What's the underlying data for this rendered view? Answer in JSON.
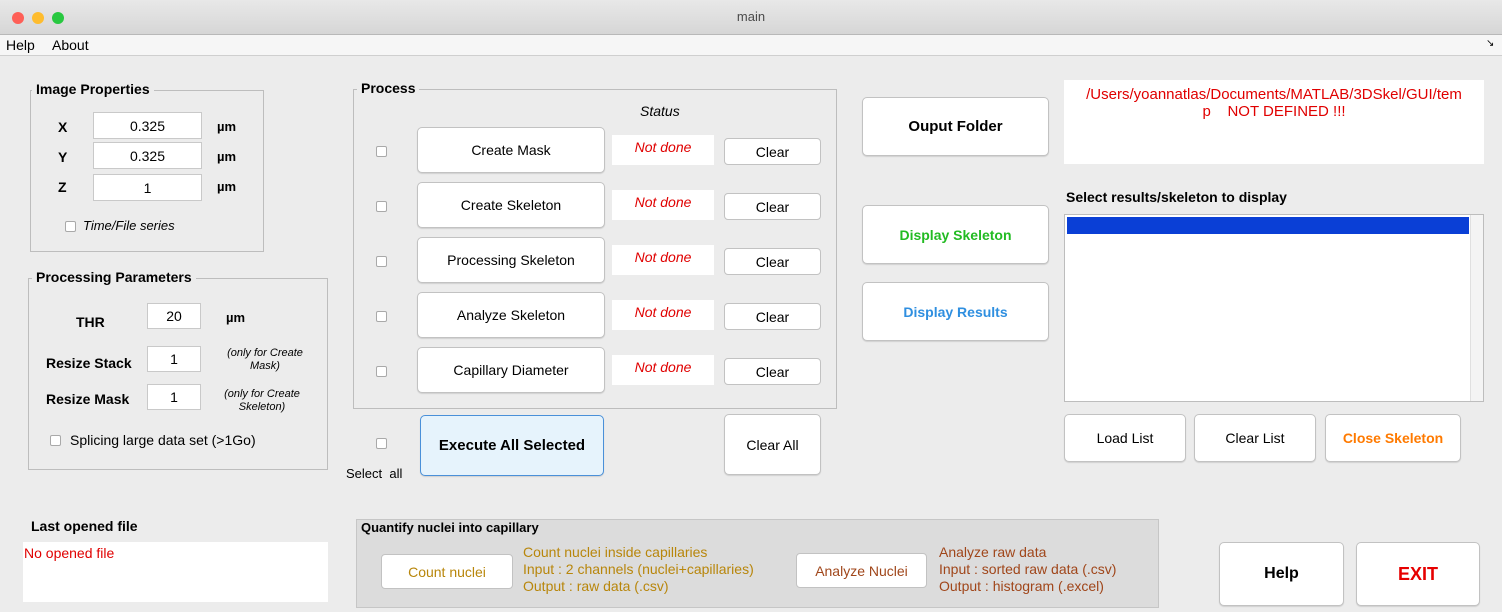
{
  "window": {
    "title": "main"
  },
  "menu": {
    "items": [
      "Help",
      "About"
    ],
    "corner_glyph": "↘"
  },
  "image_properties": {
    "title": "Image Properties",
    "x_label": "X",
    "x_value": "0.325",
    "y_label": "Y",
    "y_value": "0.325",
    "z_label": "Z",
    "z_value": "1",
    "unit": "µm",
    "time_series_label": "Time/File series"
  },
  "processing": {
    "title": "Processing Parameters",
    "thr_label": "THR",
    "thr_value": "20",
    "thr_unit": "µm",
    "resize_stack_label": "Resize Stack",
    "resize_stack_value": "1",
    "resize_stack_note": "(only for Create Mask)",
    "resize_mask_label": "Resize Mask",
    "resize_mask_value": "1",
    "resize_mask_note": "(only for Create Skeleton)",
    "splicing_label": "Splicing large data set (>1Go)"
  },
  "process": {
    "title": "Process",
    "status_header": "Status",
    "steps": [
      {
        "label": "Create Mask",
        "status": "Not done",
        "clear": "Clear"
      },
      {
        "label": "Create Skeleton",
        "status": "Not done",
        "clear": "Clear"
      },
      {
        "label": "Processing Skeleton",
        "status": "Not done",
        "clear": "Clear"
      },
      {
        "label": "Analyze Skeleton",
        "status": "Not done",
        "clear": "Clear"
      },
      {
        "label": "Capillary Diameter",
        "status": "Not done",
        "clear": "Clear"
      }
    ],
    "select_all_label": "Select  all",
    "execute_label": "Execute All Selected",
    "clear_all_label": "Clear All"
  },
  "output": {
    "folder_button": "Ouput Folder",
    "path_line1": "/Users/yoannatlas/Documents/MATLAB/3DSkel/GUI/tem",
    "path_line2": "p    NOT DEFINED !!!"
  },
  "display": {
    "skeleton_button": "Display Skeleton",
    "results_button": "Display Results"
  },
  "results": {
    "title": "Select results/skeleton to display",
    "load_list": "Load List",
    "clear_list": "Clear List",
    "close_skeleton": "Close Skeleton"
  },
  "last_file": {
    "title": "Last opened file",
    "value": "No opened file"
  },
  "quantify": {
    "title": "Quantify nuclei into capillary",
    "count_button": "Count nuclei",
    "count_desc": [
      "Count nuclei inside capillaries",
      "Input : 2 channels (nuclei+capillaries)",
      "Output : raw data (.csv)"
    ],
    "analyze_button": "Analyze Nuclei",
    "analyze_desc": [
      "Analyze raw data",
      "Input : sorted raw data (.csv)",
      "Output : histogram (.excel)"
    ]
  },
  "bottom": {
    "help": "Help",
    "exit": "EXIT"
  },
  "colors": {
    "accent_green": "#22bb22",
    "accent_blue": "#2f8fe0",
    "accent_orange": "#ff7a00",
    "error_red": "#e00000",
    "exit_red": "#e60000",
    "list_selection": "#0a3fd6"
  }
}
